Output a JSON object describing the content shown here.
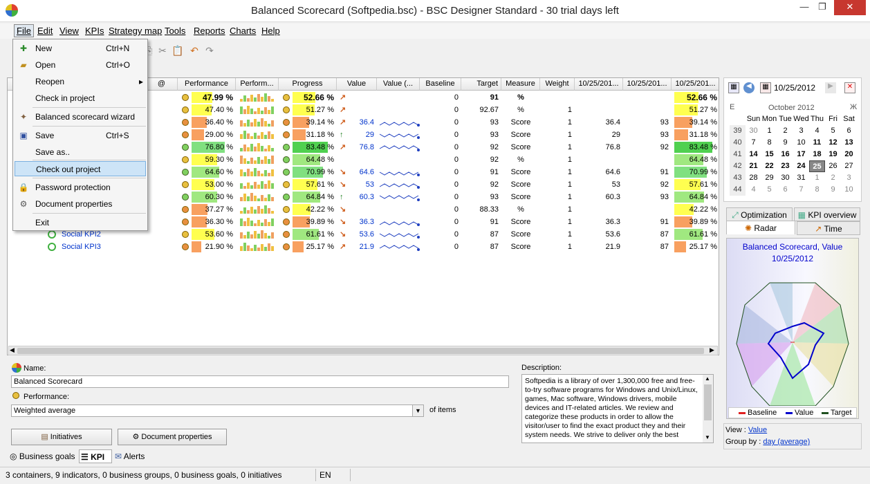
{
  "window": {
    "title": "Balanced Scorecard (Softpedia.bsc) - BSC Designer Standard - 30 trial days left"
  },
  "menubar": [
    {
      "label": "File"
    },
    {
      "label": "Edit"
    },
    {
      "label": "View"
    },
    {
      "label": "KPIs"
    },
    {
      "label": "Strategy map"
    },
    {
      "label": "Tools"
    },
    {
      "label": "Reports"
    },
    {
      "label": "Charts"
    },
    {
      "label": "Help"
    }
  ],
  "file_menu": {
    "new": {
      "label": "New",
      "shortcut": "Ctrl+N"
    },
    "open": {
      "label": "Open",
      "shortcut": "Ctrl+O"
    },
    "reopen": {
      "label": "Reopen",
      "arrow": "▸"
    },
    "checkin": {
      "label": "Check in project"
    },
    "wizard": {
      "label": "Balanced scorecard wizard"
    },
    "save": {
      "label": "Save",
      "shortcut": "Ctrl+S"
    },
    "saveas": {
      "label": "Save as.."
    },
    "checkout": {
      "label": "Check out project"
    },
    "password": {
      "label": "Password protection"
    },
    "docprops": {
      "label": "Document properties"
    },
    "exit": {
      "label": "Exit"
    }
  },
  "grid": {
    "headers": {
      "at": "@",
      "perf": "Performance",
      "perf_chart": "Perform...",
      "progress": "Progress",
      "value": "Value",
      "value_chart": "Value (...",
      "baseline": "Baseline",
      "target": "Target",
      "measure": "Measure",
      "weight": "Weight",
      "d1": "10/25/201...",
      "d2": "10/25/201...",
      "d3": "10/25/201..."
    },
    "rows": [
      {
        "name": "",
        "perf": "47.99 %",
        "perf_level": 48,
        "perf_color": "#ffff50",
        "prog": "52.66 %",
        "prog_level": 53,
        "prog_color": "#ffff50",
        "dot": "yellow",
        "pdot": "yellow",
        "trend": "↗",
        "value": "",
        "baseline": "0",
        "target": "91",
        "measure": "%",
        "weight": "",
        "d1": "",
        "d2": "",
        "d3": "52.66 %",
        "bold": true
      },
      {
        "name": "",
        "perf": "47.40 %",
        "perf_level": 47,
        "perf_color": "#ffff50",
        "prog": "51.27 %",
        "prog_level": 51,
        "prog_color": "#ffff50",
        "dot": "yellow",
        "pdot": "yellow",
        "trend": "↗",
        "value": "",
        "baseline": "0",
        "target": "92.67",
        "measure": "%",
        "weight": "1",
        "d1": "",
        "d2": "",
        "d3": "51.27 %"
      },
      {
        "name": "",
        "perf": "36.40 %",
        "perf_level": 36,
        "perf_color": "#f8a060",
        "prog": "39.14 %",
        "prog_level": 39,
        "prog_color": "#f8a060",
        "dot": "orange",
        "pdot": "orange",
        "trend": "↗",
        "value": "36.4",
        "baseline": "0",
        "target": "93",
        "measure": "Score",
        "weight": "1",
        "d1": "36.4",
        "d2": "93",
        "d3": "39.14 %"
      },
      {
        "name": "",
        "perf": "29.00 %",
        "perf_level": 29,
        "perf_color": "#f8a060",
        "prog": "31.18 %",
        "prog_level": 31,
        "prog_color": "#f8a060",
        "dot": "orange",
        "pdot": "orange",
        "trend": "↑",
        "value": "29",
        "baseline": "0",
        "target": "93",
        "measure": "Score",
        "weight": "1",
        "d1": "29",
        "d2": "93",
        "d3": "31.18 %"
      },
      {
        "name": "",
        "perf": "76.80 %",
        "perf_level": 77,
        "perf_color": "#80e080",
        "prog": "83.48 %",
        "prog_level": 83,
        "prog_color": "#50d050",
        "dot": "green",
        "pdot": "green",
        "trend": "↗",
        "value": "76.8",
        "baseline": "0",
        "target": "92",
        "measure": "Score",
        "weight": "1",
        "d1": "76.8",
        "d2": "92",
        "d3": "83.48 %"
      },
      {
        "name": "",
        "perf": "59.30 %",
        "perf_level": 59,
        "perf_color": "#ffff50",
        "prog": "64.48 %",
        "prog_level": 64,
        "prog_color": "#a0e880",
        "dot": "yellow",
        "pdot": "green",
        "trend": "",
        "value": "",
        "baseline": "0",
        "target": "92",
        "measure": "%",
        "weight": "1",
        "d1": "",
        "d2": "",
        "d3": "64.48 %"
      },
      {
        "name": "",
        "perf": "64.60 %",
        "perf_level": 65,
        "perf_color": "#a0e880",
        "prog": "70.99 %",
        "prog_level": 71,
        "prog_color": "#80e080",
        "dot": "green",
        "pdot": "green",
        "trend": "↘",
        "value": "64.6",
        "baseline": "0",
        "target": "91",
        "measure": "Score",
        "weight": "1",
        "d1": "64.6",
        "d2": "91",
        "d3": "70.99 %"
      },
      {
        "name": "",
        "perf": "53.00 %",
        "perf_level": 53,
        "perf_color": "#ffff50",
        "prog": "57.61 %",
        "prog_level": 58,
        "prog_color": "#ffff50",
        "dot": "yellow",
        "pdot": "yellow",
        "trend": "↘",
        "value": "53",
        "baseline": "0",
        "target": "92",
        "measure": "Score",
        "weight": "1",
        "d1": "53",
        "d2": "92",
        "d3": "57.61 %"
      },
      {
        "name": "",
        "perf": "60.30 %",
        "perf_level": 60,
        "perf_color": "#a0e880",
        "prog": "64.84 %",
        "prog_level": 65,
        "prog_color": "#a0e880",
        "dot": "green",
        "pdot": "green",
        "trend": "↑",
        "value": "60.3",
        "baseline": "0",
        "target": "93",
        "measure": "Score",
        "weight": "1",
        "d1": "60.3",
        "d2": "93",
        "d3": "64.84 %"
      },
      {
        "name": "",
        "perf": "37.27 %",
        "perf_level": 37,
        "perf_color": "#f8a060",
        "prog": "42.22 %",
        "prog_level": 42,
        "prog_color": "#ffff50",
        "dot": "orange",
        "pdot": "yellow",
        "trend": "↘",
        "value": "",
        "baseline": "0",
        "target": "88.33",
        "measure": "%",
        "weight": "1",
        "d1": "",
        "d2": "",
        "d3": "42.22 %"
      },
      {
        "name": "",
        "perf": "36.30 %",
        "perf_level": 36,
        "perf_color": "#f8a060",
        "prog": "39.89 %",
        "prog_level": 40,
        "prog_color": "#f8a060",
        "dot": "orange",
        "pdot": "orange",
        "trend": "↘",
        "value": "36.3",
        "baseline": "0",
        "target": "91",
        "measure": "Score",
        "weight": "1",
        "d1": "36.3",
        "d2": "91",
        "d3": "39.89 %"
      },
      {
        "name": "Social KPI2",
        "perf": "53.60 %",
        "perf_level": 54,
        "perf_color": "#ffff50",
        "prog": "61.61 %",
        "prog_level": 62,
        "prog_color": "#a0e880",
        "dot": "yellow",
        "pdot": "orange",
        "trend": "↘",
        "value": "53.6",
        "baseline": "0",
        "target": "87",
        "measure": "Score",
        "weight": "1",
        "d1": "53.6",
        "d2": "87",
        "d3": "61.61 %"
      },
      {
        "name": "Social KPI3",
        "perf": "21.90 %",
        "perf_level": 22,
        "perf_color": "#f8a060",
        "prog": "25.17 %",
        "prog_level": 25,
        "prog_color": "#f8a060",
        "dot": "orange",
        "pdot": "orange",
        "trend": "↗",
        "value": "21.9",
        "baseline": "0",
        "target": "87",
        "measure": "Score",
        "weight": "1",
        "d1": "21.9",
        "d2": "87",
        "d3": "25.17 %"
      }
    ]
  },
  "form": {
    "name_label": "Name:",
    "name_value": "Balanced Scorecard",
    "perf_label": "Performance:",
    "perf_value": "Weighted average",
    "of_items": "of items",
    "initiatives": "Initiatives",
    "docprops": "Document properties",
    "desc_label": "Description:",
    "desc_text": "Softpedia is a library of over 1,300,000 free and free-to-try software programs for Windows and Unix/Linux, games, Mac software, Windows drivers, mobile devices and IT-related articles. We review and categorize these products in order to allow the visitor/user to find the exact product they and their system needs. We strive to deliver only the best"
  },
  "calendar": {
    "date": "10/25/2012",
    "month": "October 2012",
    "prev": "E",
    "next": "Ж",
    "days": [
      "Sun",
      "Mon",
      "Tue",
      "Wed",
      "Thu",
      "Fri",
      "Sat"
    ],
    "weeks": [
      {
        "wk": "39",
        "d": [
          "30",
          "1",
          "2",
          "3",
          "4",
          "5",
          "6"
        ]
      },
      {
        "wk": "40",
        "d": [
          "7",
          "8",
          "9",
          "10",
          "11",
          "12",
          "13"
        ]
      },
      {
        "wk": "41",
        "d": [
          "14",
          "15",
          "16",
          "17",
          "18",
          "19",
          "20"
        ]
      },
      {
        "wk": "42",
        "d": [
          "21",
          "22",
          "23",
          "24",
          "25",
          "26",
          "27"
        ]
      },
      {
        "wk": "43",
        "d": [
          "28",
          "29",
          "30",
          "31",
          "1",
          "2",
          "3"
        ]
      },
      {
        "wk": "44",
        "d": [
          "4",
          "5",
          "6",
          "7",
          "8",
          "9",
          "10"
        ]
      }
    ]
  },
  "chart_tabs": {
    "optimization": "Optimization",
    "kpi_overview": "KPI overview",
    "radar": "Radar",
    "time": "Time"
  },
  "radar": {
    "title": "Balanced Scorecard, Value",
    "date": "10/25/2012",
    "legend": [
      {
        "name": "Baseline",
        "color": "#e02020"
      },
      {
        "name": "Value",
        "color": "#0000cc"
      },
      {
        "name": "Target",
        "color": "#205020"
      }
    ]
  },
  "view": {
    "view_label": "View :",
    "view_value": "Value",
    "group_label": "Group by :",
    "group_value": "day (average)"
  },
  "bottom_tabs": {
    "goals": "Business goals",
    "kpi": "KPI",
    "alerts": "Alerts"
  },
  "status": {
    "text": "3 containers, 9 indicators, 0 business groups, 0 business goals, 0 initiatives",
    "lang": "EN"
  }
}
